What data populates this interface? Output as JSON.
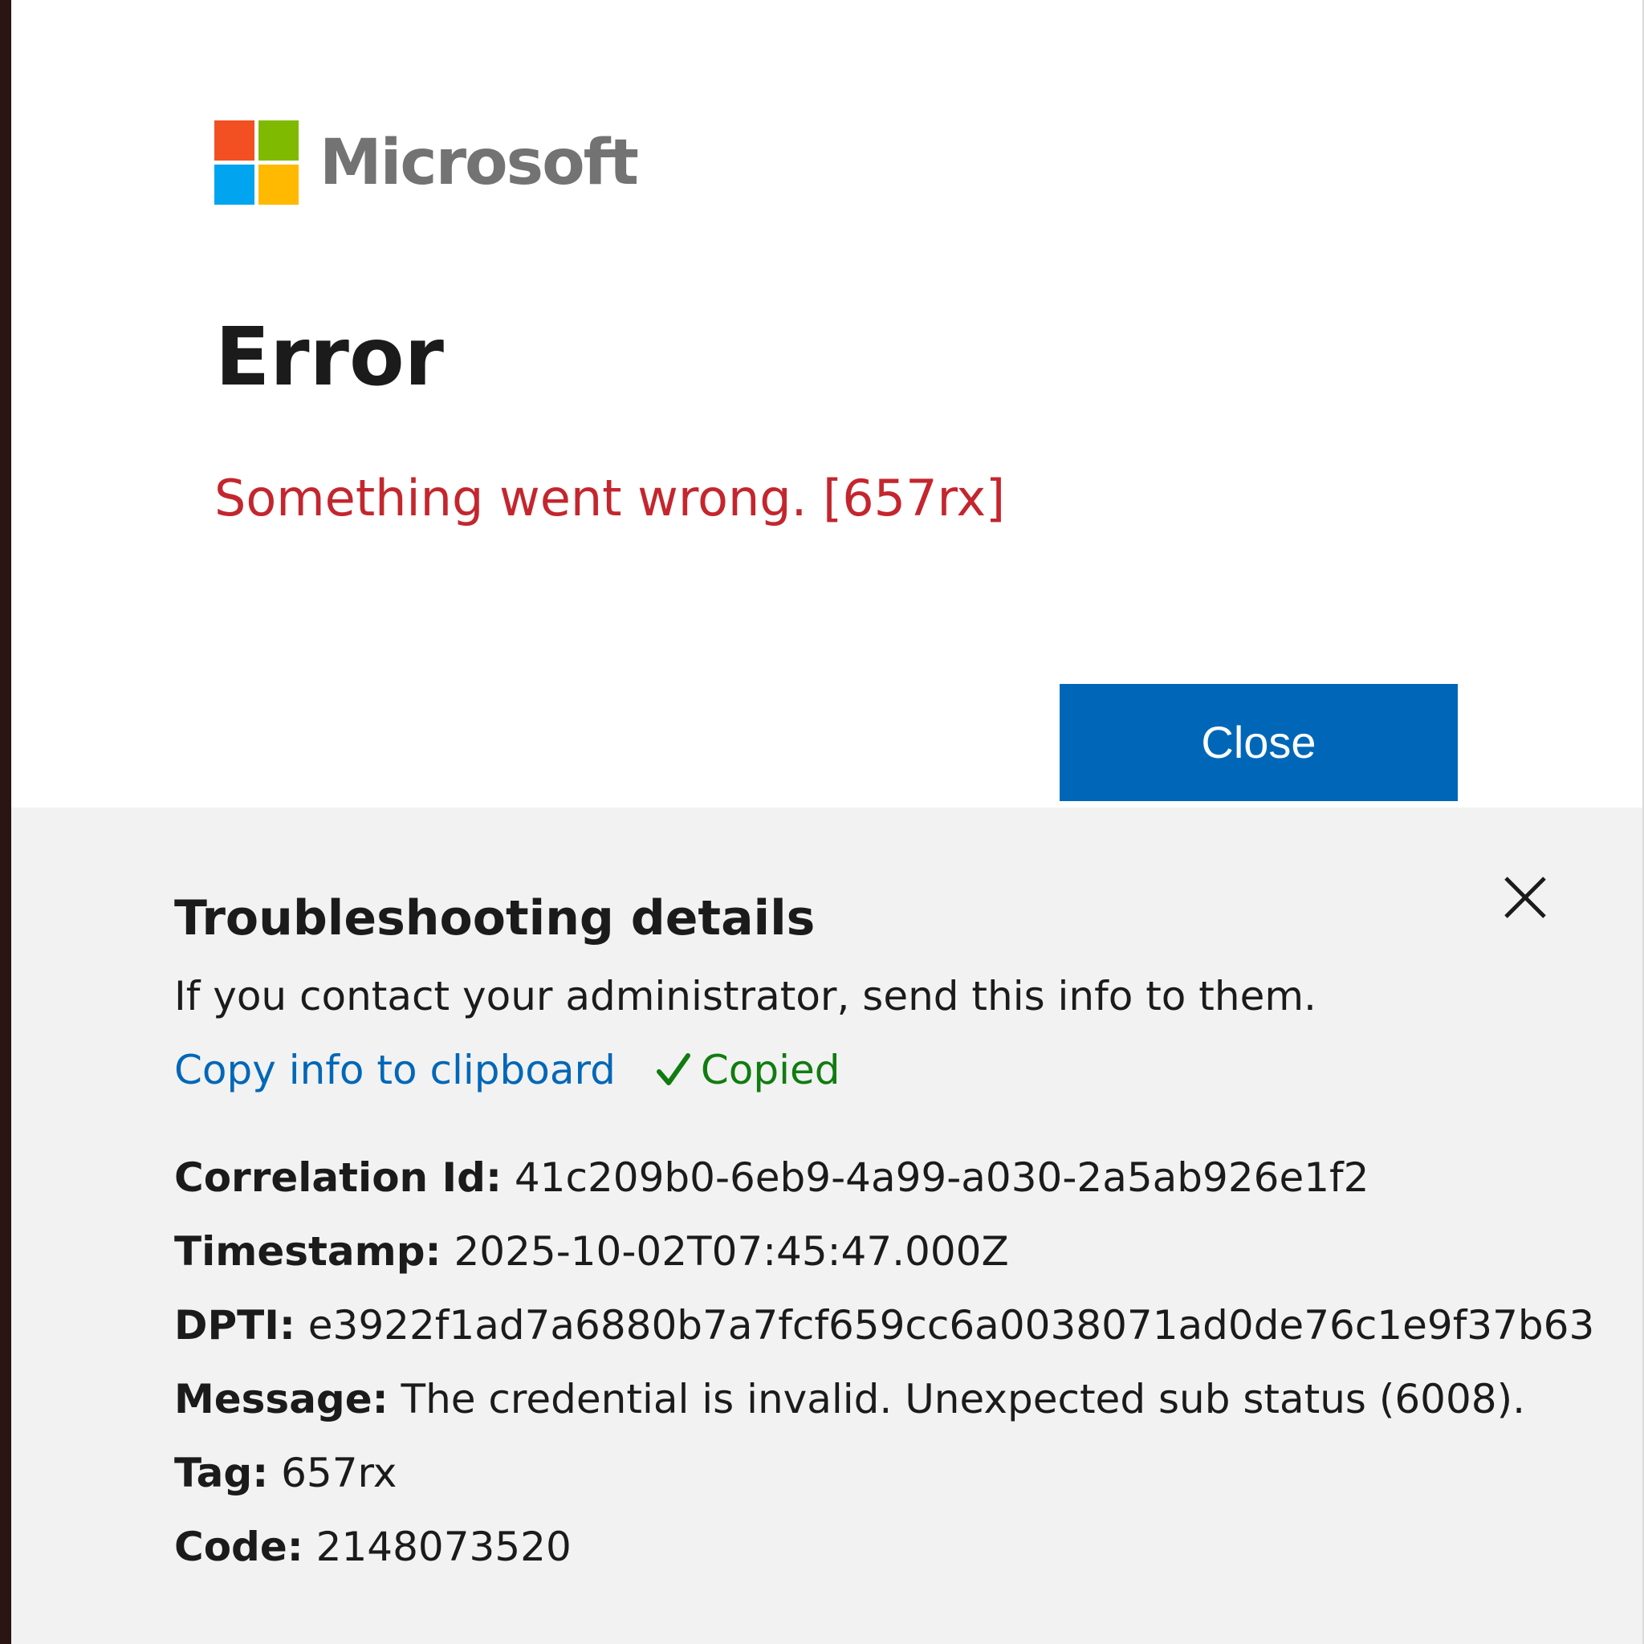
{
  "brand": {
    "name": "Microsoft",
    "logo_colors": [
      "#f25022",
      "#7fba00",
      "#00a4ef",
      "#ffb900"
    ]
  },
  "dialog": {
    "title": "Error",
    "message": "Something went wrong. [657rx]",
    "close_label": "Close"
  },
  "troubleshooting": {
    "title": "Troubleshooting details",
    "description": "If you contact your administrator, send this info to them.",
    "copy_link": "Copy info to clipboard",
    "copied_label": "Copied",
    "items": [
      {
        "label": "Correlation Id:",
        "value": "41c209b0-6eb9-4a99-a030-2a5ab926e1f2"
      },
      {
        "label": "Timestamp:",
        "value": "2025-10-02T07:45:47.000Z"
      },
      {
        "label": "DPTI:",
        "value": "e3922f1ad7a6880b7a7fcf659cc6a0038071ad0de76c1e9f37b63"
      },
      {
        "label": "Message:",
        "value": "The credential is invalid. Unexpected sub status (6008)."
      },
      {
        "label": "Tag:",
        "value": "657rx"
      },
      {
        "label": "Code:",
        "value": "2148073520"
      }
    ]
  },
  "colors": {
    "accent": "#0067b8",
    "error": "#c4262e",
    "success": "#107c10",
    "details_bg": "#f2f2f2"
  },
  "icons": {
    "dismiss": "close-icon",
    "copied": "check-icon"
  }
}
